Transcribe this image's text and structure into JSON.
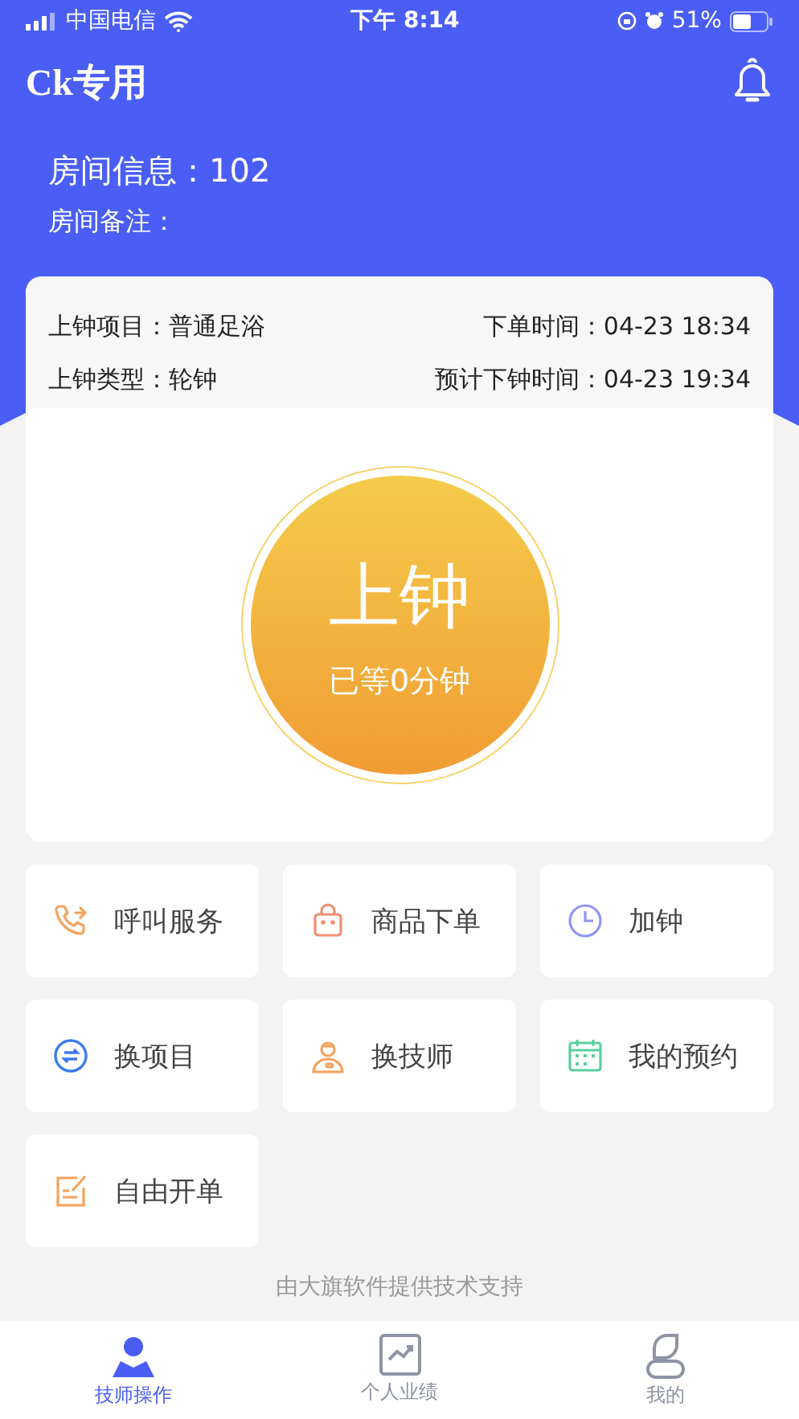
{
  "status_bar": {
    "carrier": "中国电信",
    "time": "下午 8:14",
    "battery": "51%"
  },
  "header": {
    "title": "Ck专用",
    "room_info": "房间信息：102",
    "room_note": "房间备注："
  },
  "order": {
    "project_label": "上钟项目：",
    "project": "普通足浴",
    "order_time_label": "下单时间：",
    "order_time": "04-23 18:34",
    "type_label": "上钟类型：",
    "type": "轮钟",
    "end_time_label": "预计下钟时间：",
    "end_time": "04-23 19:34"
  },
  "clock_button": {
    "label": "上钟",
    "wait": "已等0分钟"
  },
  "actions": [
    {
      "label": "呼叫服务",
      "kind": "call"
    },
    {
      "label": "商品下单",
      "kind": "shop"
    },
    {
      "label": "加钟",
      "kind": "clock"
    },
    {
      "label": "换项目",
      "kind": "swap"
    },
    {
      "label": "换技师",
      "kind": "tech"
    },
    {
      "label": "我的预约",
      "kind": "calendar"
    },
    {
      "label": "自由开单",
      "kind": "edit"
    }
  ],
  "footer": "由大旗软件提供技术支持",
  "tabs": [
    {
      "label": "技师操作",
      "kind": "user",
      "selected": true
    },
    {
      "label": "个人业绩",
      "kind": "chart",
      "selected": false
    },
    {
      "label": "我的",
      "kind": "profile",
      "selected": false
    }
  ]
}
